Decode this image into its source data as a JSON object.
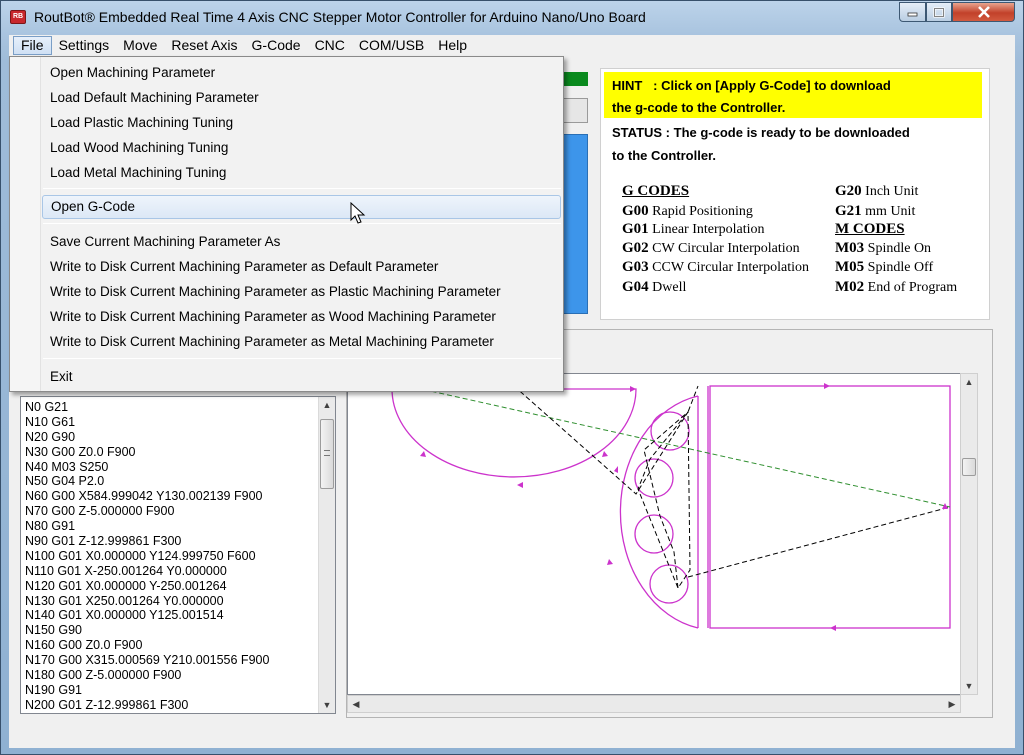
{
  "window": {
    "title": "RoutBot® Embedded Real Time 4 Axis CNC Stepper Motor Controller for Arduino Nano/Uno Board",
    "app_icon_text": "RB"
  },
  "menubar": {
    "items": [
      "File",
      "Settings",
      "Move",
      "Reset Axis",
      "G-Code",
      "CNC",
      "COM/USB",
      "Help"
    ]
  },
  "file_menu": {
    "group1": [
      "Open Machining Parameter",
      "Load Default Machining Parameter",
      "Load Plastic Machining Tuning",
      "Load Wood Machining Tuning",
      "Load Metal Machining Tuning"
    ],
    "group2": [
      "Open G-Code"
    ],
    "group3": [
      "Save Current Machining Parameter As",
      "Write to Disk Current Machining Parameter as Default Parameter",
      "Write to Disk Current Machining Parameter as Plastic Machining Parameter",
      "Write to Disk Current Machining Parameter as Wood Machining Parameter",
      "Write to Disk Current Machining Parameter as Metal Machining Parameter"
    ],
    "group4": [
      "Exit"
    ]
  },
  "hint": {
    "line1": "HINT   : Click on [Apply G-Code] to download",
    "line2": "the g-code to the Controller."
  },
  "status": {
    "line1": "STATUS : The g-code is ready to be downloaded",
    "line2": "to the Controller."
  },
  "codes": {
    "g_header": "G CODES",
    "m_header": "M CODES",
    "left": [
      {
        "code": "G00",
        "desc": "Rapid Positioning"
      },
      {
        "code": "G01",
        "desc": "Linear Interpolation"
      },
      {
        "code": "G02",
        "desc": "CW Circular Interpolation"
      },
      {
        "code": "G03",
        "desc": "CCW Circular Interpolation"
      },
      {
        "code": "G04",
        "desc": "Dwell"
      }
    ],
    "right_top": [
      {
        "code": "G20",
        "desc": "Inch Unit"
      },
      {
        "code": "G21",
        "desc": "mm Unit"
      }
    ],
    "right_bottom": [
      {
        "code": "M03",
        "desc": "Spindle On"
      },
      {
        "code": "M05",
        "desc": "Spindle Off"
      },
      {
        "code": "M02",
        "desc": "End of Program"
      }
    ]
  },
  "gcode_lines": [
    "N0 G21",
    "N10 G61",
    "N20 G90",
    "N30 G00 Z0.0 F900",
    "N40 M03 S250",
    "N50 G04 P2.0",
    "N60 G00 X584.999042 Y130.002139 F900",
    "N70 G00 Z-5.000000 F900",
    "N80 G91",
    "N90 G01 Z-12.999861 F300",
    "N100 G01 X0.000000 Y124.999750 F600",
    "N110 G01 X-250.001264 Y0.000000",
    "N120 G01 X0.000000 Y-250.001264",
    "N130 G01 X250.001264 Y0.000000",
    "N140 G01 X0.000000 Y125.001514",
    "N150 G90",
    "N160 G00 Z0.0 F900",
    "N170 G00 X315.000569 Y210.001556 F900",
    "N180 G00 Z-5.000000 F900",
    "N190 G91",
    "N200 G01 Z-12.999861 F300"
  ],
  "colors": {
    "toolpath": "#cc33cc",
    "rapid_move": "#2f8f2f",
    "travel": "#000000",
    "hint_bg": "#ffff00",
    "status_green": "#0a8a1e",
    "accent_blue": "#3d95ea"
  }
}
